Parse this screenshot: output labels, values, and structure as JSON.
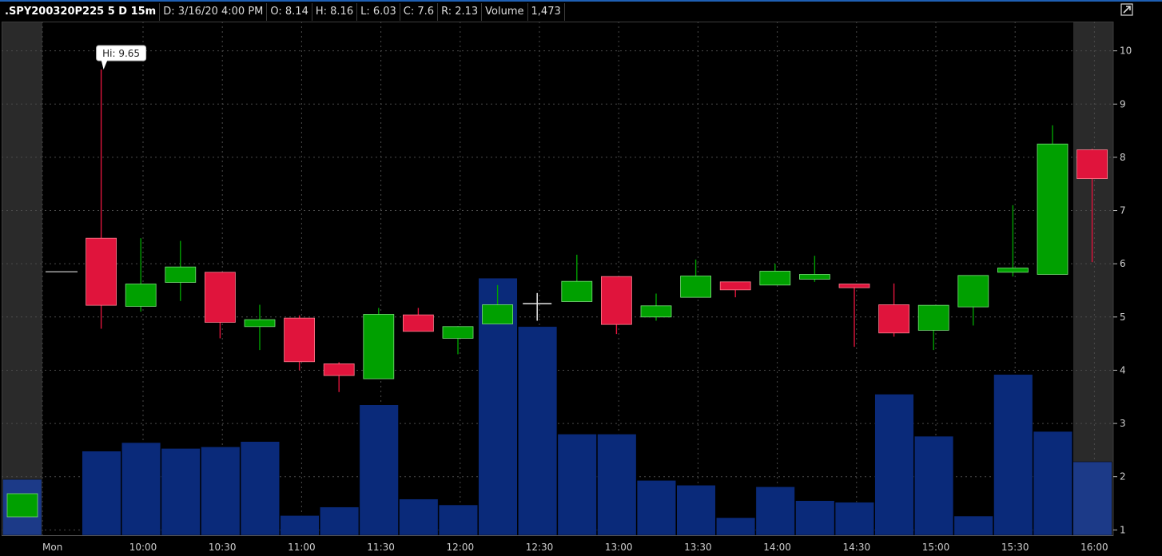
{
  "header": {
    "symbol": ".SPY200320P225 5 D 15m",
    "date": "D: 3/16/20 4:00 PM",
    "open": "O: 8.14",
    "high": "H: 8.16",
    "low": "L: 6.03",
    "close": "C: 7.6",
    "range": "R: 2.13",
    "volume_label": "Volume",
    "volume_value": "1,473",
    "corner_icon": "collapse-arrow-icon"
  },
  "colors": {
    "up": "#00a000",
    "down": "#e0143c",
    "volume": "#0a2a7a",
    "volume_dim": "#1c3a88",
    "grid": "#4a4a4a",
    "background": "#000000",
    "shade": "#2a2a2a"
  },
  "chart_data": {
    "type": "candlestick",
    "title": ".SPY200320P225 5 D 15m",
    "x_labels": [
      "Mon",
      "10:00",
      "10:30",
      "11:00",
      "11:30",
      "12:00",
      "12:30",
      "13:00",
      "13:30",
      "14:00",
      "14:30",
      "15:00",
      "15:30",
      "16:00"
    ],
    "y_ticks": [
      1,
      2,
      3,
      4,
      5,
      6,
      7,
      8,
      9,
      10
    ],
    "ylim": [
      0.9,
      10.55
    ],
    "grid": true,
    "annotation": "Hi: 9.65",
    "candles": [
      {
        "o": 5.85,
        "h": 5.85,
        "l": 5.85,
        "c": 5.85,
        "dir": "flat"
      },
      {
        "o": 6.48,
        "h": 9.65,
        "l": 4.78,
        "c": 5.22,
        "dir": "down"
      },
      {
        "o": 5.2,
        "h": 6.48,
        "l": 5.1,
        "c": 5.62,
        "dir": "up"
      },
      {
        "o": 5.65,
        "h": 6.43,
        "l": 5.3,
        "c": 5.94,
        "dir": "up"
      },
      {
        "o": 5.84,
        "h": 5.84,
        "l": 4.6,
        "c": 4.9,
        "dir": "down"
      },
      {
        "o": 4.82,
        "h": 5.23,
        "l": 4.38,
        "c": 4.95,
        "dir": "up"
      },
      {
        "o": 4.98,
        "h": 5.03,
        "l": 4.0,
        "c": 4.16,
        "dir": "down"
      },
      {
        "o": 4.12,
        "h": 4.15,
        "l": 3.59,
        "c": 3.9,
        "dir": "down"
      },
      {
        "o": 3.84,
        "h": 5.17,
        "l": 3.84,
        "c": 5.05,
        "dir": "up"
      },
      {
        "o": 5.04,
        "h": 5.17,
        "l": 4.73,
        "c": 4.73,
        "dir": "down"
      },
      {
        "o": 4.6,
        "h": 4.83,
        "l": 4.3,
        "c": 4.82,
        "dir": "up"
      },
      {
        "o": 4.87,
        "h": 5.6,
        "l": 4.87,
        "c": 5.23,
        "dir": "up"
      },
      {
        "o": 5.25,
        "h": 5.45,
        "l": 4.93,
        "c": 5.25,
        "dir": "cross"
      },
      {
        "o": 5.29,
        "h": 6.17,
        "l": 5.29,
        "c": 5.67,
        "dir": "up"
      },
      {
        "o": 5.76,
        "h": 5.76,
        "l": 4.68,
        "c": 4.86,
        "dir": "down"
      },
      {
        "o": 5.0,
        "h": 5.44,
        "l": 4.93,
        "c": 5.21,
        "dir": "up"
      },
      {
        "o": 5.37,
        "h": 6.08,
        "l": 5.37,
        "c": 5.77,
        "dir": "up"
      },
      {
        "o": 5.66,
        "h": 5.66,
        "l": 5.37,
        "c": 5.51,
        "dir": "down"
      },
      {
        "o": 5.6,
        "h": 6.0,
        "l": 5.6,
        "c": 5.86,
        "dir": "up"
      },
      {
        "o": 5.71,
        "h": 6.15,
        "l": 5.66,
        "c": 5.8,
        "dir": "up"
      },
      {
        "o": 5.62,
        "h": 5.62,
        "l": 4.44,
        "c": 5.55,
        "dir": "down"
      },
      {
        "o": 5.23,
        "h": 5.63,
        "l": 4.63,
        "c": 4.7,
        "dir": "down"
      },
      {
        "o": 4.75,
        "h": 5.22,
        "l": 4.38,
        "c": 5.22,
        "dir": "up"
      },
      {
        "o": 5.19,
        "h": 5.78,
        "l": 4.84,
        "c": 5.78,
        "dir": "up"
      },
      {
        "o": 5.84,
        "h": 7.1,
        "l": 5.76,
        "c": 5.92,
        "dir": "up"
      },
      {
        "o": 5.8,
        "h": 8.6,
        "l": 5.8,
        "c": 8.25,
        "dir": "up"
      },
      {
        "o": 8.14,
        "h": 8.16,
        "l": 6.03,
        "c": 7.6,
        "dir": "down"
      }
    ],
    "volume_bars": [
      1.95,
      0,
      2.48,
      2.64,
      2.53,
      2.56,
      2.66,
      1.27,
      1.43,
      3.35,
      1.58,
      1.47,
      5.73,
      4.82,
      2.8,
      2.8,
      1.93,
      1.84,
      1.23,
      1.81,
      1.55,
      1.52,
      3.55,
      2.76,
      1.26,
      3.92,
      2.85,
      2.28
    ]
  }
}
